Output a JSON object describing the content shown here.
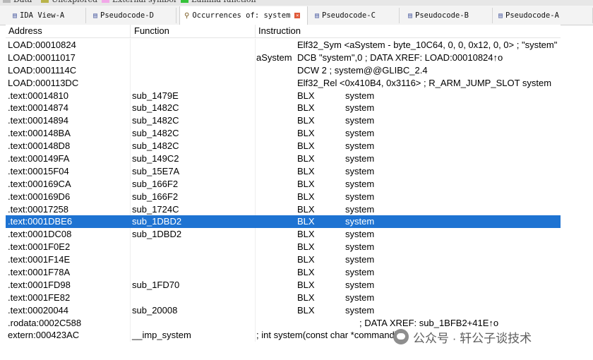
{
  "legend": {
    "items": [
      {
        "label": "Data",
        "color": "#b7b7b7"
      },
      {
        "label": "Unexplored",
        "color": "#b9b34a"
      },
      {
        "label": "External symbol",
        "color": "#f2a8e8"
      },
      {
        "label": "Lumina function",
        "color": "#35c23a"
      }
    ]
  },
  "tabs": [
    {
      "label": "IDA View-A",
      "icon": "ida-view-icon",
      "active": false
    },
    {
      "label": "Pseudocode-D",
      "icon": "pseudocode-icon",
      "active": false
    },
    {
      "label": "Occurrences of: system",
      "icon": "occurrences-icon",
      "active": true
    },
    {
      "label": "Pseudocode-C",
      "icon": "pseudocode-icon",
      "active": false
    },
    {
      "label": "Pseudocode-B",
      "icon": "pseudocode-icon",
      "active": false
    },
    {
      "label": "Pseudocode-A",
      "icon": "pseudocode-icon",
      "active": false
    }
  ],
  "columns": {
    "address": "Address",
    "function": "Function",
    "instruction": "Instruction"
  },
  "rows": [
    {
      "address": "LOAD:00010824",
      "function": "",
      "label": "",
      "mnemonic": "Elf32_Sym <aSystem - byte_10C64, 0, 0, 0x12, 0, 0> ; \"system\"",
      "operand": ""
    },
    {
      "address": "LOAD:00011017",
      "function": "",
      "label": "aSystem",
      "mnemonic": "DCB \"system\",0          ; DATA XREF: LOAD:00010824↑o",
      "operand": ""
    },
    {
      "address": "LOAD:0001114C",
      "function": "",
      "label": "",
      "mnemonic": "DCW 2                   ; system@@GLIBC_2.4",
      "operand": ""
    },
    {
      "address": "LOAD:000113DC",
      "function": "",
      "label": "",
      "mnemonic": "Elf32_Rel <0x410B4, 0x3116> ; R_ARM_JUMP_SLOT system",
      "operand": ""
    },
    {
      "address": ".text:00014810",
      "function": "sub_1479E",
      "label": "",
      "mnemonic": "BLX",
      "operand": "system"
    },
    {
      "address": ".text:00014874",
      "function": "sub_1482C",
      "label": "",
      "mnemonic": "BLX",
      "operand": "system"
    },
    {
      "address": ".text:00014894",
      "function": "sub_1482C",
      "label": "",
      "mnemonic": "BLX",
      "operand": "system"
    },
    {
      "address": ".text:000148BA",
      "function": "sub_1482C",
      "label": "",
      "mnemonic": "BLX",
      "operand": "system"
    },
    {
      "address": ".text:000148D8",
      "function": "sub_1482C",
      "label": "",
      "mnemonic": "BLX",
      "operand": "system"
    },
    {
      "address": ".text:000149FA",
      "function": "sub_149C2",
      "label": "",
      "mnemonic": "BLX",
      "operand": "system"
    },
    {
      "address": ".text:00015F04",
      "function": "sub_15E7A",
      "label": "",
      "mnemonic": "BLX",
      "operand": "system"
    },
    {
      "address": ".text:000169CA",
      "function": "sub_166F2",
      "label": "",
      "mnemonic": "BLX",
      "operand": "system"
    },
    {
      "address": ".text:000169D6",
      "function": "sub_166F2",
      "label": "",
      "mnemonic": "BLX",
      "operand": "system"
    },
    {
      "address": ".text:00017258",
      "function": "sub_1724C",
      "label": "",
      "mnemonic": "BLX",
      "operand": "system"
    },
    {
      "address": ".text:0001DBE6",
      "function": "sub_1DBD2",
      "label": "",
      "mnemonic": "BLX",
      "operand": "system",
      "selected": true
    },
    {
      "address": ".text:0001DC08",
      "function": "sub_1DBD2",
      "label": "",
      "mnemonic": "BLX",
      "operand": "system"
    },
    {
      "address": ".text:0001F0E2",
      "function": "",
      "label": "",
      "mnemonic": "BLX",
      "operand": "system"
    },
    {
      "address": ".text:0001F14E",
      "function": "",
      "label": "",
      "mnemonic": "BLX",
      "operand": "system"
    },
    {
      "address": ".text:0001F78A",
      "function": "",
      "label": "",
      "mnemonic": "BLX",
      "operand": "system"
    },
    {
      "address": ".text:0001FD98",
      "function": "sub_1FD70",
      "label": "",
      "mnemonic": "BLX",
      "operand": "system"
    },
    {
      "address": ".text:0001FE82",
      "function": "",
      "label": "",
      "mnemonic": "BLX",
      "operand": "system"
    },
    {
      "address": ".text:00020044",
      "function": "sub_20008",
      "label": "",
      "mnemonic": "BLX",
      "operand": "system"
    },
    {
      "address": ".rodata:0002C588",
      "function": "",
      "label": "",
      "mnemonic": "",
      "operand": "; DATA XREF: sub_1BFB2+41E↑o"
    },
    {
      "address": "extern:000423AC",
      "function": "__imp_system",
      "label": "; int system(const char *command)",
      "mnemonic": "",
      "operand": ""
    }
  ],
  "watermark": {
    "text": "公众号 · 轩公子谈技术"
  },
  "colors": {
    "selection": "#1e73d2",
    "tab_close": "#e05a3a"
  }
}
